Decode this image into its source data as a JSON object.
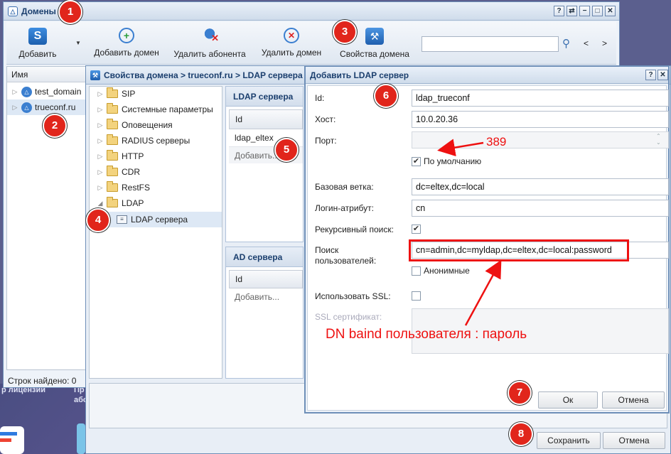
{
  "main_window": {
    "title": "Домены",
    "controls": [
      "?",
      "⇄",
      "−",
      "□",
      "✕"
    ],
    "toolbar": {
      "add": "Добавить",
      "add_domain": "Добавить домен",
      "delete_subscriber": "Удалить абонента",
      "delete_domain": "Удалить домен",
      "domain_properties": "Свойства домена",
      "search_value": "",
      "prev": "<",
      "next": ">"
    },
    "grid": {
      "column": "Имя",
      "rows": [
        "test_domain",
        "trueconf.ru"
      ],
      "footer": "Строк найдено: 0"
    }
  },
  "background": {
    "text1": "р лицензий",
    "text2": "Пр",
    "text3": "або"
  },
  "props_window": {
    "title": "Свойства домена > trueconf.ru > LDAP сервера",
    "tree": [
      {
        "label": "SIP",
        "expanded": false
      },
      {
        "label": "Системные параметры",
        "expanded": false
      },
      {
        "label": "Оповещения",
        "expanded": false
      },
      {
        "label": "RADIUS серверы",
        "expanded": false
      },
      {
        "label": "HTTP",
        "expanded": false
      },
      {
        "label": "CDR",
        "expanded": false
      },
      {
        "label": "RestFS",
        "expanded": false
      },
      {
        "label": "LDAP",
        "expanded": true
      }
    ],
    "tree_child": "LDAP сервера",
    "ldap_panel": {
      "title": "LDAP сервера",
      "column": "Id",
      "rows": [
        "ldap_eltex"
      ],
      "add_row": "Добавить..."
    },
    "ad_panel": {
      "title": "AD сервера",
      "column": "Id",
      "add_row": "Добавить..."
    },
    "save_label": "Сохранить",
    "cancel_label": "Отмена"
  },
  "ldap_dialog": {
    "title": "Добавить LDAP сервер",
    "controls": [
      "?",
      "✕"
    ],
    "fields": {
      "id_label": "Id:",
      "id_value": "ldap_trueconf",
      "host_label": "Хост:",
      "host_value": "10.0.20.36",
      "port_label": "Порт:",
      "port_value": "",
      "default_label": "По умолчанию",
      "default_checked": true,
      "base_label": "Базовая ветка:",
      "base_value": "dc=eltex,dc=local",
      "login_label": "Логин-атрибут:",
      "login_value": "cn",
      "recursive_label": "Рекурсивный поиск:",
      "recursive_checked": true,
      "search_label_1": "Поиск",
      "search_label_2": "пользователей:",
      "search_value": "cn=admin,dc=myldap,dc=eltex,dc=local:password",
      "anonymous_label": "Анонимные",
      "anonymous_checked": false,
      "ssl_label": "Использовать SSL:",
      "ssl_checked": false,
      "ssl_cert_label": "SSL сертификат:"
    },
    "ok_label": "Ок",
    "cancel_label": "Отмена"
  },
  "annotations": {
    "port_note": "389",
    "dn_note": "DN baind пользователя : пароль",
    "badges": [
      "1",
      "2",
      "3",
      "4",
      "5",
      "6",
      "7",
      "8"
    ],
    "color": "#e11111"
  }
}
